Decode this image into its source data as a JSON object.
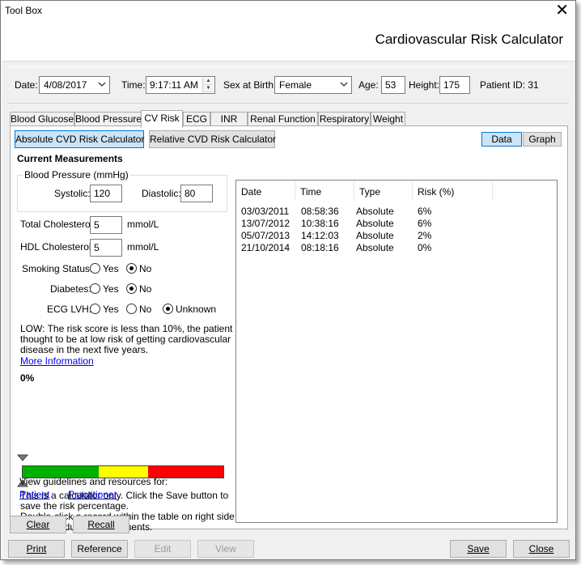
{
  "window": {
    "title": "Tool Box",
    "heading": "Cardiovascular Risk Calculator"
  },
  "patient_bar": {
    "date_label": "Date:",
    "date_value": "4/08/2017",
    "time_label": "Time:",
    "time_value": "9:17:11 AM",
    "sex_label": "Sex at Birth:",
    "sex_value": "Female",
    "age_label": "Age:",
    "age_value": "53",
    "height_label": "Height:",
    "height_value": "175",
    "patient_id": "Patient ID: 31"
  },
  "tabs": [
    {
      "label": "Blood Glucose"
    },
    {
      "label": "Blood Pressure"
    },
    {
      "label": "CV Risk",
      "active": true
    },
    {
      "label": "ECG"
    },
    {
      "label": "INR"
    },
    {
      "label": "Renal Function"
    },
    {
      "label": "Respiratory"
    },
    {
      "label": "Weight"
    }
  ],
  "calc_buttons": {
    "absolute": "Absolute CVD Risk Calculator",
    "relative": "Relative CVD Risk Calculator"
  },
  "view_toggle": {
    "data": "Data",
    "graph": "Graph"
  },
  "measurements": {
    "heading": "Current Measurements",
    "bp_group": "Blood Pressure (mmHg)",
    "systolic_label": "Systolic:",
    "systolic_value": "120",
    "diastolic_label": "Diastolic:",
    "diastolic_value": "80",
    "total_chol_label": "Total Cholesterol:",
    "total_chol_value": "5",
    "total_chol_unit": "mmol/L",
    "hdl_chol_label": "HDL Cholesterol:",
    "hdl_chol_value": "5",
    "hdl_chol_unit": "mmol/L",
    "smoking_label": "Smoking Status:",
    "smoking_yes": "Yes",
    "smoking_no": "No",
    "smoking_selected": "No",
    "diabetes_label": "Diabetes:",
    "diabetes_yes": "Yes",
    "diabetes_no": "No",
    "diabetes_selected": "No",
    "ecg_label": "ECG LVH:",
    "ecg_yes": "Yes",
    "ecg_no": "No",
    "ecg_unknown": "Unknown",
    "ecg_selected": "Unknown"
  },
  "result": {
    "message_line1": "LOW: The risk score is less than 10%, the patient is",
    "message_line2": "thought to be at low risk of getting cardiovascular",
    "message_line3": "disease in the next five years.",
    "more_info": "More Information",
    "risk_percent": "0%",
    "risk_value": 0,
    "gauge_colors": {
      "green": "#00b000",
      "yellow": "#ffff00",
      "red": "#ff0000"
    }
  },
  "notes": {
    "line1": "This is a calculator only. Click the Save button to",
    "line2": "save the risk percentage.",
    "line3": "Double-click a record within the table on right side to",
    "line4": "view individual measurements.",
    "guidelines": "View guidelines and resources for:",
    "patient_link": "Patient",
    "practitioner_link": "Practitioner"
  },
  "records_table": {
    "columns": [
      "Date",
      "Time",
      "Type",
      "Risk (%)"
    ],
    "rows": [
      [
        "03/03/2011",
        "08:58:36",
        "Absolute",
        "6%"
      ],
      [
        "13/07/2012",
        "10:38:16",
        "Absolute",
        "6%"
      ],
      [
        "05/07/2013",
        "14:12:03",
        "Absolute",
        "2%"
      ],
      [
        "21/10/2014",
        "08:18:16",
        "Absolute",
        "0%"
      ]
    ]
  },
  "panel_buttons": {
    "clear": "Clear",
    "recall": "Recall"
  },
  "footer_buttons": {
    "print": "Print",
    "reference": "Reference",
    "edit": "Edit",
    "view": "View",
    "save": "Save",
    "close": "Close"
  }
}
